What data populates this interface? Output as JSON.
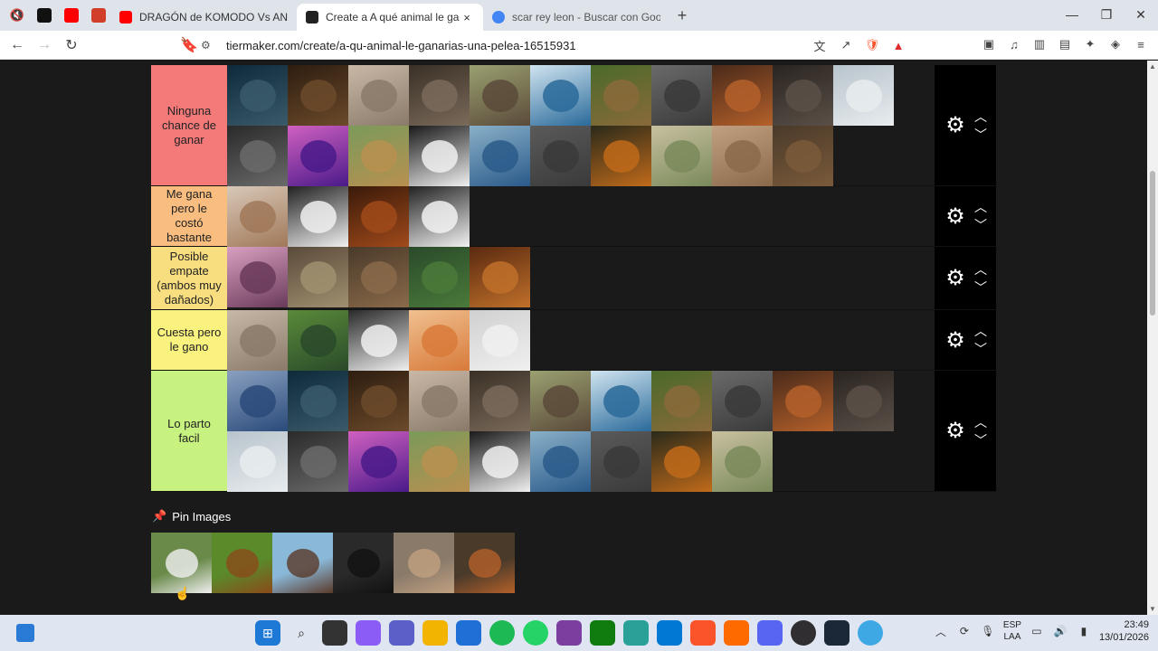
{
  "browser": {
    "tabs": [
      {
        "title": "DRAGÓN de KOMODO Vs ANGUILA",
        "favicon_color": "#ff0000",
        "active": false
      },
      {
        "title": "Create a A qué animal le ganarías",
        "favicon_color": "#222222",
        "active": true
      },
      {
        "title": "scar rey leon - Buscar con Google",
        "favicon_color": "#4285f4",
        "active": false
      }
    ],
    "close_symbol": "×",
    "new_tab_symbol": "+",
    "url": "tiermaker.com/create/a-qu-animal-le-ganarias-una-pelea-16515931"
  },
  "tiers": [
    {
      "label": "Ninguna chance de ganar",
      "color": "#f47a7a",
      "item_count": 21
    },
    {
      "label": "Me gana pero le costó bastante",
      "color": "#f9bd7f",
      "item_count": 4
    },
    {
      "label": "Posible empate (ambos muy dañados)",
      "color": "#f9de7f",
      "item_count": 5
    },
    {
      "label": "Cuesta pero le gano",
      "color": "#f9f27f",
      "item_count": 5
    },
    {
      "label": "Lo parto facil",
      "color": "#c8f27f",
      "item_count": 20
    }
  ],
  "pin_images": {
    "title": "Pin Images",
    "count": 6
  },
  "taskbar": {
    "lang_line1": "ESP",
    "lang_line2": "LAA",
    "time": "23:49",
    "date": "13/01/2026"
  }
}
